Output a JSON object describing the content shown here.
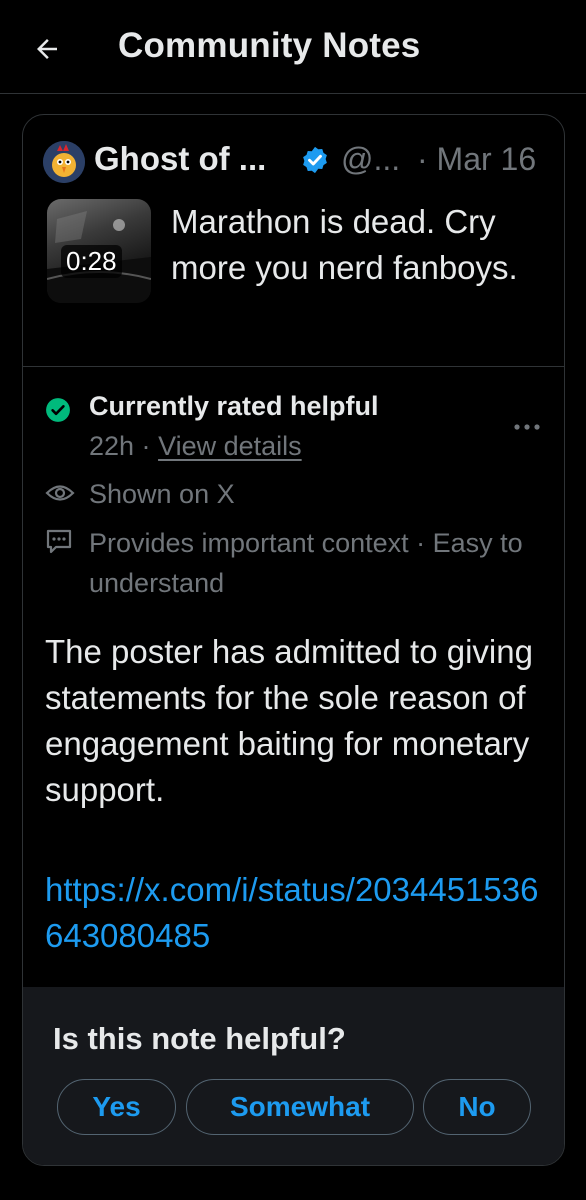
{
  "header": {
    "title": "Community Notes",
    "back_icon": "arrow-left-icon"
  },
  "tweet": {
    "author_name": "Ghost of ...",
    "handle": "@...",
    "date": "· Mar 16",
    "verified_icon": "verified-badge-icon",
    "media": {
      "duration": "0:28"
    },
    "text": "Marathon is dead. Cry more you nerd fanboys."
  },
  "note": {
    "status": "Currently rated helpful",
    "status_icon": "check-circle-icon",
    "age": "22h ·",
    "view_details": "View details",
    "shown_on": "Shown on X",
    "shown_icon": "eye-icon",
    "reasons": "Provides important context · Easy to understand",
    "reasons_icon": "message-dots-icon",
    "more_icon": "more-horizontal-icon",
    "body": "The poster has admitted to giving statements for the sole reason of engagement baiting for monetary support.",
    "link": "https://x.com/i/status/2034451536643080485"
  },
  "feedback": {
    "question": "Is this note helpful?",
    "yes": "Yes",
    "somewhat": "Somewhat",
    "no": "No"
  },
  "colors": {
    "accent": "#1d9bf0",
    "helpful_green": "#00ba7c",
    "muted_text": "#71767b",
    "border": "#2f3336"
  }
}
